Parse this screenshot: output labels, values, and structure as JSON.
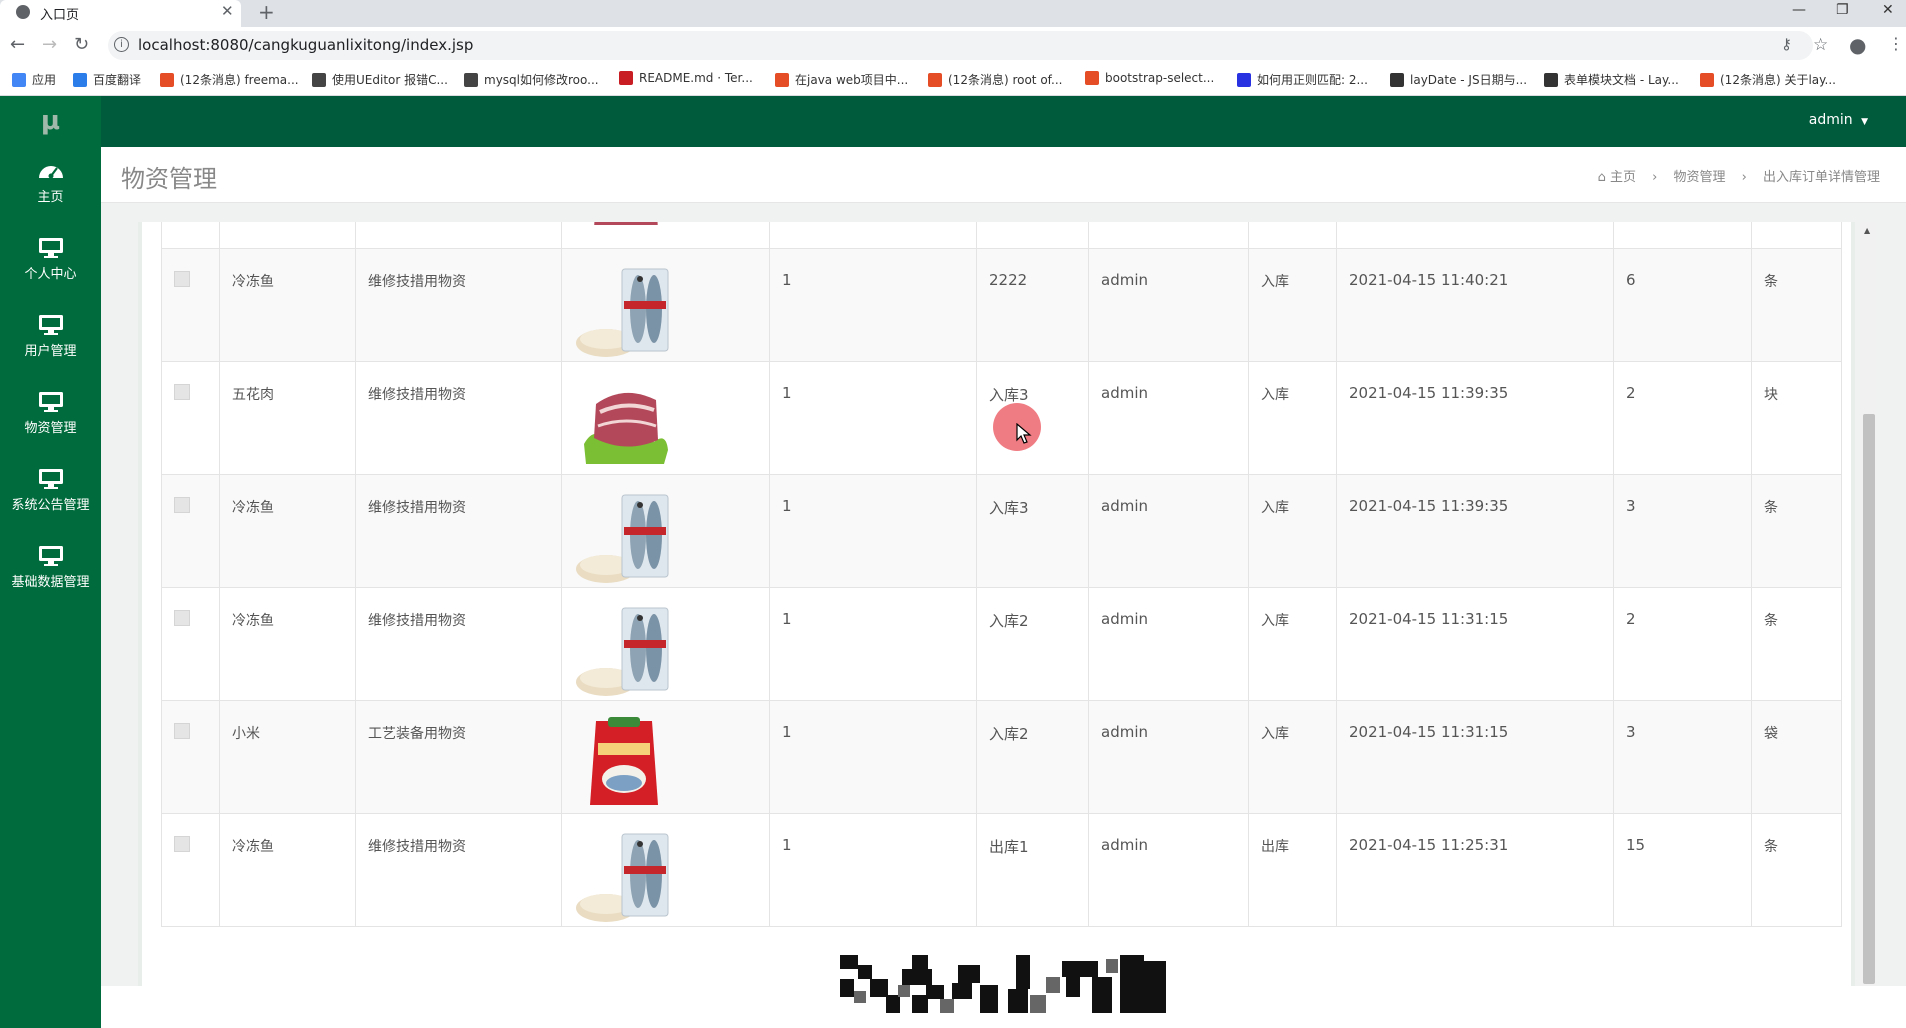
{
  "browser": {
    "tab_title": "入口页",
    "url": "localhost:8080/cangkuguanlixitong/index.jsp",
    "bookmarks": [
      {
        "label": "应用",
        "color": "#4285f4"
      },
      {
        "label": "百度翻译",
        "color": "#2b7de9"
      },
      {
        "label": "(12条消息) freema...",
        "color": "#e44d26"
      },
      {
        "label": "使用UEditor 报错C...",
        "color": "#444444"
      },
      {
        "label": "mysql如何修改roo...",
        "color": "#444444"
      },
      {
        "label": "README.md · Ter...",
        "color": "#c71d23"
      },
      {
        "label": "在java web项目中...",
        "color": "#e44d26"
      },
      {
        "label": "(12条消息) root of...",
        "color": "#e44d26"
      },
      {
        "label": "bootstrap-select...",
        "color": "#e44d26"
      },
      {
        "label": "如何用正则匹配: 2...",
        "color": "#2932e1"
      },
      {
        "label": "layDate - JS日期与...",
        "color": "#333333"
      },
      {
        "label": "表单模块文档 - Lay...",
        "color": "#333333"
      },
      {
        "label": "(12条消息) 关于lay...",
        "color": "#e44d26"
      }
    ]
  },
  "app": {
    "logo": "μ",
    "user": "admin",
    "accent": "#006b3c",
    "topbar_color": "#005a3c",
    "menu": [
      {
        "label": "主页",
        "icon": "dashboard-icon"
      },
      {
        "label": "个人中心",
        "icon": "monitor-icon"
      },
      {
        "label": "用户管理",
        "icon": "monitor-icon"
      },
      {
        "label": "物资管理",
        "icon": "monitor-icon"
      },
      {
        "label": "系统公告管理",
        "icon": "monitor-icon"
      },
      {
        "label": "基础数据管理",
        "icon": "monitor-icon"
      }
    ]
  },
  "page": {
    "title": "物资管理",
    "breadcrumb": [
      "主页",
      "物资管理",
      "出入库订单详情管理"
    ]
  },
  "table": {
    "rows": [
      {
        "name": "",
        "type": "",
        "image": "pork-image",
        "qty": "",
        "order": "",
        "operator": "",
        "io_type": "",
        "time": "",
        "count": "",
        "unit": ""
      },
      {
        "name": "冷冻鱼",
        "type": "维修技措用物资",
        "image": "fish-image",
        "qty": "1",
        "order": "2222",
        "operator": "admin",
        "io_type": "入库",
        "time": "2021-04-15 11:40:21",
        "count": "6",
        "unit": "条"
      },
      {
        "name": "五花肉",
        "type": "维修技措用物资",
        "image": "pork-image",
        "qty": "1",
        "order": "入库3",
        "operator": "admin",
        "io_type": "入库",
        "time": "2021-04-15 11:39:35",
        "count": "2",
        "unit": "块"
      },
      {
        "name": "冷冻鱼",
        "type": "维修技措用物资",
        "image": "fish-image",
        "qty": "1",
        "order": "入库3",
        "operator": "admin",
        "io_type": "入库",
        "time": "2021-04-15 11:39:35",
        "count": "3",
        "unit": "条"
      },
      {
        "name": "冷冻鱼",
        "type": "维修技措用物资",
        "image": "fish-image",
        "qty": "1",
        "order": "入库2",
        "operator": "admin",
        "io_type": "入库",
        "time": "2021-04-15 11:31:15",
        "count": "2",
        "unit": "条"
      },
      {
        "name": "小米",
        "type": "工艺装备用物资",
        "image": "rice-bag-image",
        "qty": "1",
        "order": "入库2",
        "operator": "admin",
        "io_type": "入库",
        "time": "2021-04-15 11:31:15",
        "count": "3",
        "unit": "袋"
      },
      {
        "name": "冷冻鱼",
        "type": "维修技措用物资",
        "image": "fish-image",
        "qty": "1",
        "order": "出库1",
        "operator": "admin",
        "io_type": "出库",
        "time": "2021-04-15 11:25:31",
        "count": "15",
        "unit": "条"
      }
    ]
  }
}
